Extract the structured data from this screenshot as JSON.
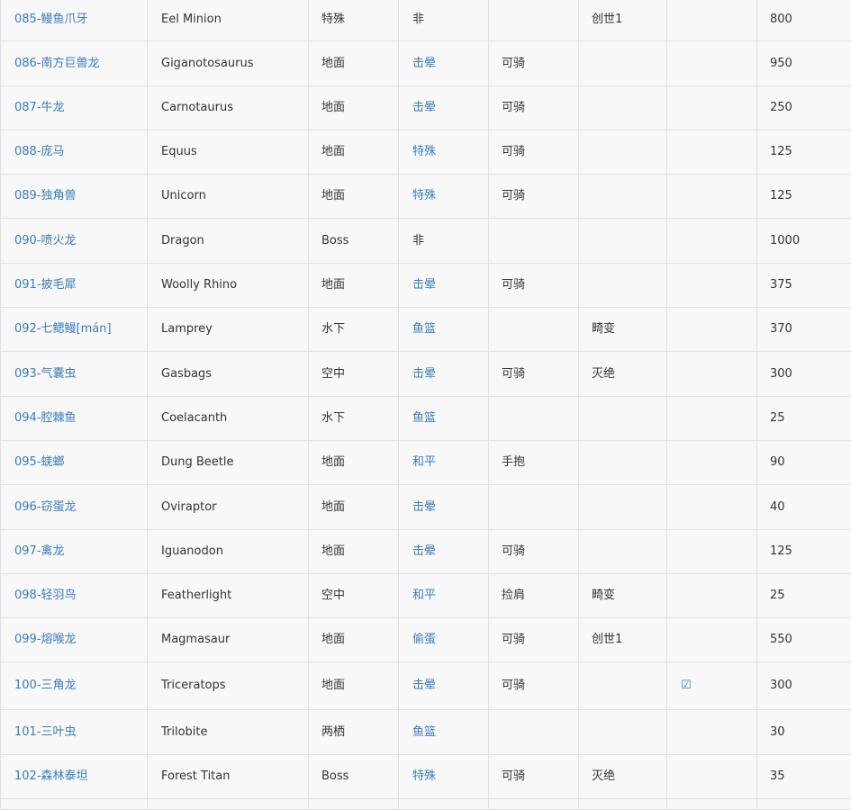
{
  "table": {
    "rows": [
      {
        "creature": "085-鳗鱼爪牙",
        "english": "Eel Minion",
        "habitat": "特殊",
        "taming": "非",
        "trait": "",
        "dlc": "创世1",
        "flag": "",
        "value": "800"
      },
      {
        "creature": "086-南方巨兽龙",
        "english": "Giganotosaurus",
        "habitat": "地面",
        "taming": "击晕",
        "trait": "可骑",
        "dlc": "",
        "flag": "",
        "value": "950"
      },
      {
        "creature": "087-牛龙",
        "english": "Carnotaurus",
        "habitat": "地面",
        "taming": "击晕",
        "trait": "可骑",
        "dlc": "",
        "flag": "",
        "value": "250"
      },
      {
        "creature": "088-庞马",
        "english": "Equus",
        "habitat": "地面",
        "taming": "特殊",
        "trait": "可骑",
        "dlc": "",
        "flag": "",
        "value": "125"
      },
      {
        "creature": "089-独角兽",
        "english": "Unicorn",
        "habitat": "地面",
        "taming": "特殊",
        "trait": "可骑",
        "dlc": "",
        "flag": "",
        "value": "125"
      },
      {
        "creature": "090-喷火龙",
        "english": "Dragon",
        "habitat": "Boss",
        "taming": "非",
        "trait": "",
        "dlc": "",
        "flag": "",
        "value": "1000"
      },
      {
        "creature": "091-披毛犀",
        "english": "Woolly Rhino",
        "habitat": "地面",
        "taming": "击晕",
        "trait": "可骑",
        "dlc": "",
        "flag": "",
        "value": "375"
      },
      {
        "creature": "092-七鳃鳗[mán]",
        "english": "Lamprey",
        "habitat": "水下",
        "taming": "鱼篮",
        "trait": "",
        "dlc": "畸变",
        "flag": "",
        "value": "370"
      },
      {
        "creature": "093-气囊虫",
        "english": "Gasbags",
        "habitat": "空中",
        "taming": "击晕",
        "trait": "可骑",
        "dlc": "灭绝",
        "flag": "",
        "value": "300"
      },
      {
        "creature": "094-腔棘鱼",
        "english": "Coelacanth",
        "habitat": "水下",
        "taming": "鱼篮",
        "trait": "",
        "dlc": "",
        "flag": "",
        "value": "25"
      },
      {
        "creature": "095-蜣螂",
        "english": "Dung Beetle",
        "habitat": "地面",
        "taming": "和平",
        "trait": "手抱",
        "dlc": "",
        "flag": "",
        "value": "90"
      },
      {
        "creature": "096-窃蛋龙",
        "english": "Oviraptor",
        "habitat": "地面",
        "taming": "击晕",
        "trait": "",
        "dlc": "",
        "flag": "",
        "value": "40"
      },
      {
        "creature": "097-禽龙",
        "english": "Iguanodon",
        "habitat": "地面",
        "taming": "击晕",
        "trait": "可骑",
        "dlc": "",
        "flag": "",
        "value": "125"
      },
      {
        "creature": "098-轻羽鸟",
        "english": "Featherlight",
        "habitat": "空中",
        "taming": "和平",
        "trait": "捡肩",
        "dlc": "畸变",
        "flag": "",
        "value": "25"
      },
      {
        "creature": "099-熔喉龙",
        "english": "Magmasaur",
        "habitat": "地面",
        "taming": "偷蛋",
        "trait": "可骑",
        "dlc": "创世1",
        "flag": "",
        "value": "550"
      },
      {
        "creature": "100-三角龙",
        "english": "Triceratops",
        "habitat": "地面",
        "taming": "击晕",
        "trait": "可骑",
        "dlc": "",
        "flag": "☑",
        "value": "300"
      },
      {
        "creature": "101-三叶虫",
        "english": "Trilobite",
        "habitat": "两栖",
        "taming": "鱼篮",
        "trait": "",
        "dlc": "",
        "flag": "",
        "value": "30"
      },
      {
        "creature": "102-森林泰坦",
        "english": "Forest Titan",
        "habitat": "Boss",
        "taming": "特殊",
        "trait": "可骑",
        "dlc": "灭绝",
        "flag": "",
        "value": "35"
      },
      {
        "creature": "",
        "english": "",
        "habitat": "",
        "taming": "",
        "trait": "",
        "dlc": "",
        "flag": "",
        "value": ""
      }
    ]
  },
  "colors": {
    "link": "#3a7cb8",
    "text": "#333333",
    "border": "#e1e1e1",
    "cell_bg": "#f8f8f8"
  }
}
